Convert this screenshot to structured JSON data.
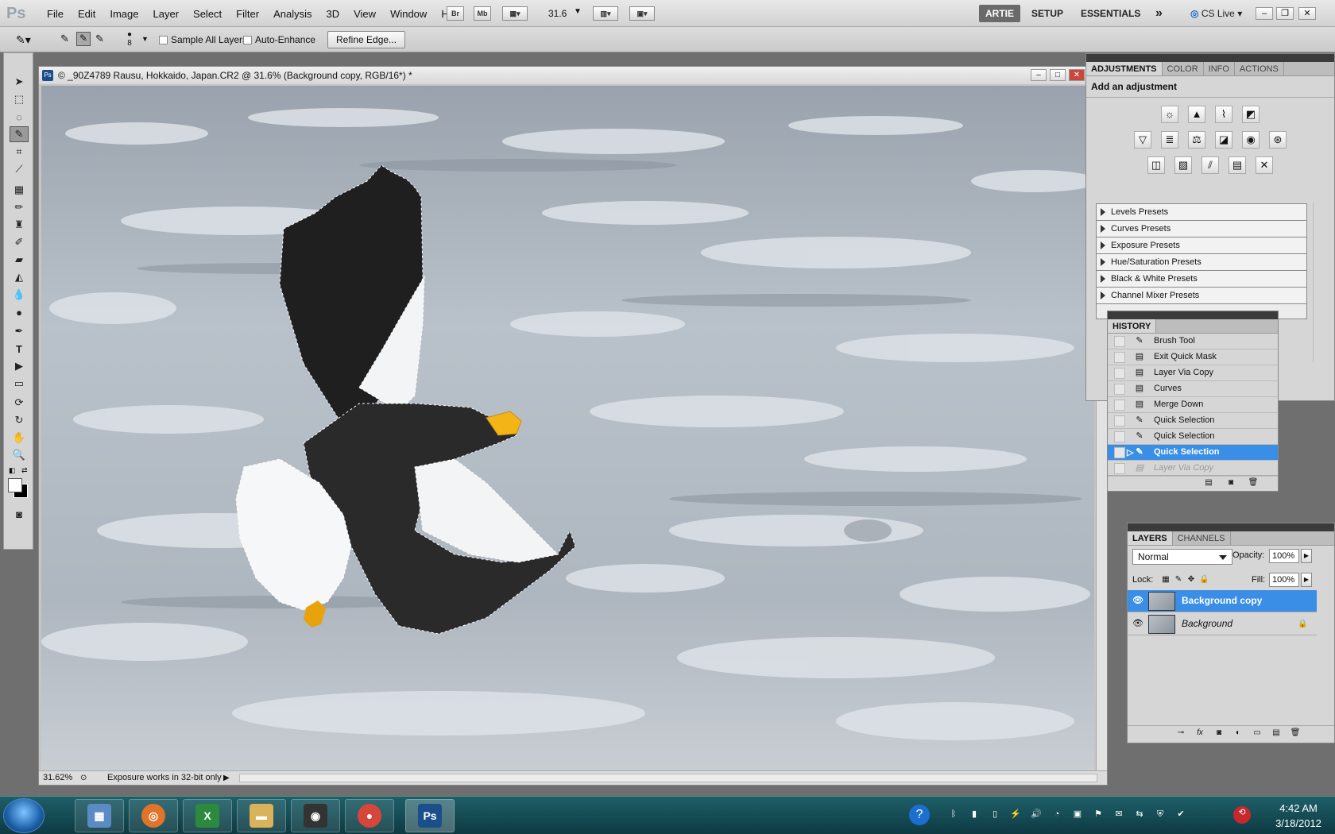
{
  "app": {
    "logo": "Ps",
    "menus": [
      "File",
      "Edit",
      "Image",
      "Layer",
      "Select",
      "Filter",
      "Analysis",
      "3D",
      "View",
      "Window",
      "Help"
    ],
    "bridge_label": "Br",
    "minibridge_label": "Mb",
    "zoom_value": "31.6",
    "workspaces": [
      "ARTIE",
      "SETUP",
      "ESSENTIALS"
    ],
    "more_label": "»",
    "cslive_label": "CS Live"
  },
  "options": {
    "brush_size": "8",
    "sample_all_layers": "Sample All Layers",
    "auto_enhance": "Auto-Enhance",
    "refine_edge": "Refine Edge..."
  },
  "document": {
    "title": "© _90Z4789  Rausu, Hokkaido, Japan.CR2 @ 31.6% (Background copy, RGB/16*) *",
    "zoom_pct": "31.62%",
    "status": "Exposure works in 32-bit only"
  },
  "adjustments": {
    "tabs": [
      "ADJUSTMENTS",
      "COLOR",
      "INFO",
      "ACTIONS"
    ],
    "heading": "Add an adjustment",
    "presets": [
      "Levels Presets",
      "Curves Presets",
      "Exposure Presets",
      "Hue/Saturation Presets",
      "Black & White Presets",
      "Channel Mixer Presets"
    ]
  },
  "history": {
    "tab": "HISTORY",
    "items": [
      "Brush Tool",
      "Exit Quick Mask",
      "Layer Via Copy",
      "Curves",
      "Merge Down",
      "Quick Selection",
      "Quick Selection",
      "Quick Selection",
      "Layer Via Copy"
    ],
    "selected_index": 7
  },
  "layers": {
    "tabs": [
      "LAYERS",
      "CHANNELS"
    ],
    "blend_mode": "Normal",
    "opacity_label": "Opacity:",
    "opacity": "100%",
    "lock_label": "Lock:",
    "fill_label": "Fill:",
    "fill": "100%",
    "items": [
      "Background copy",
      "Background"
    ]
  },
  "taskbar": {
    "time": "4:42 AM",
    "date": "3/18/2012",
    "ps_label": "Ps"
  }
}
